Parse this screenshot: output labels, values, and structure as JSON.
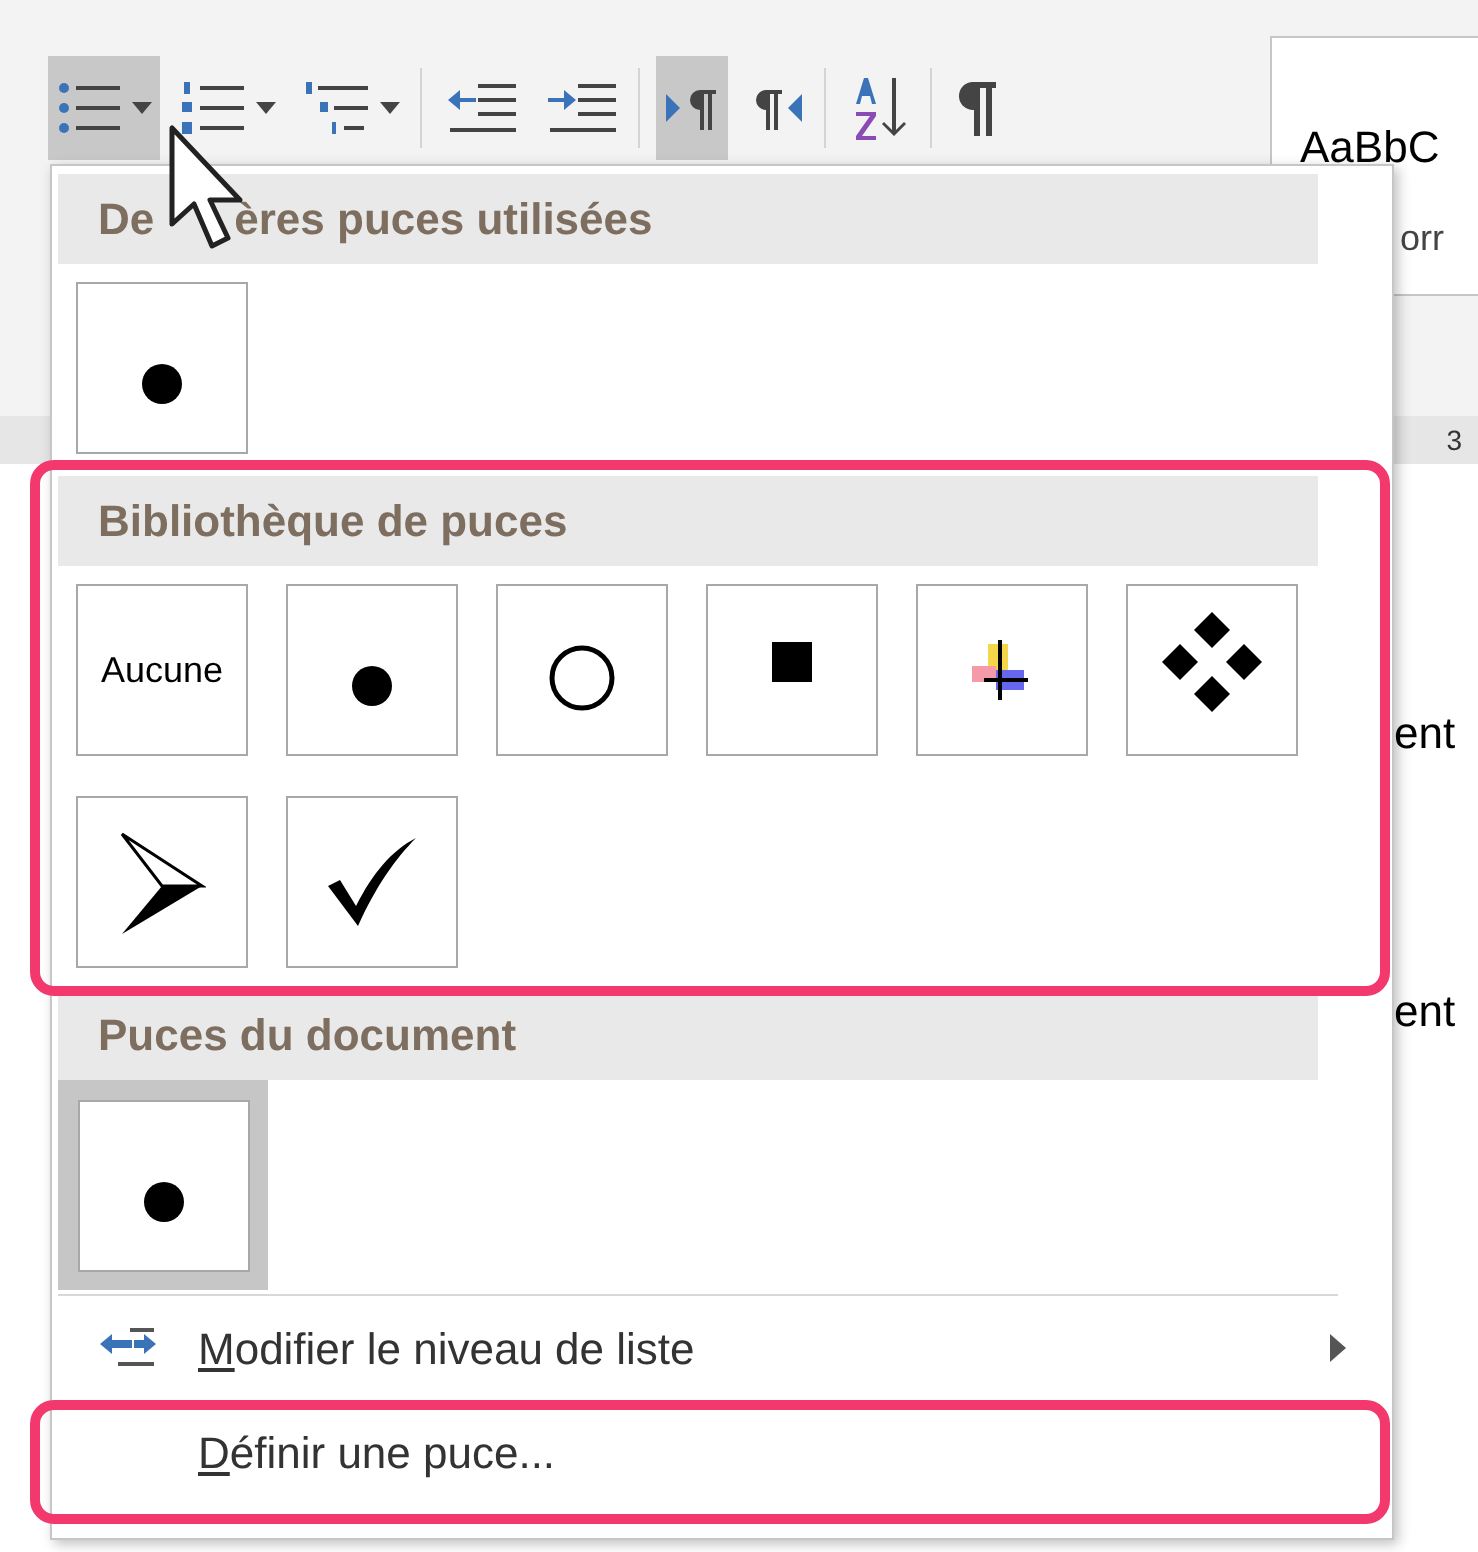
{
  "toolbar": {
    "buttons": [
      {
        "kind": "bullets",
        "selected": true,
        "dropdown": true
      },
      {
        "kind": "numbering",
        "selected": false,
        "dropdown": true
      },
      {
        "kind": "multilevel",
        "selected": false,
        "dropdown": true
      },
      {
        "kind": "outdent",
        "selected": false,
        "dropdown": false
      },
      {
        "kind": "indent",
        "selected": false,
        "dropdown": false
      },
      {
        "kind": "ltr",
        "selected": true,
        "dropdown": false
      },
      {
        "kind": "rtl",
        "selected": false,
        "dropdown": false
      },
      {
        "kind": "sort",
        "selected": false,
        "dropdown": false
      },
      {
        "kind": "pilcrow",
        "selected": false,
        "dropdown": false
      }
    ]
  },
  "style_gallery": {
    "preview": "AaBbC",
    "label": "orr"
  },
  "ruler": {
    "mark": "3"
  },
  "document": {
    "lines": [
      "ent",
      "ent"
    ]
  },
  "menu": {
    "sections": [
      {
        "heading_parts": [
          "De",
          "ères puces utilisées"
        ],
        "highlighted": false,
        "bullets": [
          {
            "kind": "dot",
            "selected": false
          }
        ]
      },
      {
        "heading_parts": [
          "Bibliothèque de puces"
        ],
        "highlighted": true,
        "bullets": [
          {
            "kind": "text",
            "label": "Aucune",
            "selected": false
          },
          {
            "kind": "dot",
            "selected": false
          },
          {
            "kind": "circle",
            "selected": false
          },
          {
            "kind": "square",
            "selected": false
          },
          {
            "kind": "cross",
            "selected": false
          },
          {
            "kind": "diamonds",
            "selected": false
          },
          {
            "kind": "arrow",
            "selected": false
          },
          {
            "kind": "check",
            "selected": false
          }
        ]
      },
      {
        "heading_parts": [
          "Puces du document"
        ],
        "highlighted": false,
        "bullets": [
          {
            "kind": "dot",
            "selected": true
          }
        ]
      }
    ],
    "items": [
      {
        "kind": "submenu",
        "label": "Modifier le niveau de liste",
        "highlighted": false
      },
      {
        "kind": "command",
        "label": "Définir une puce...",
        "highlighted": true
      }
    ]
  }
}
